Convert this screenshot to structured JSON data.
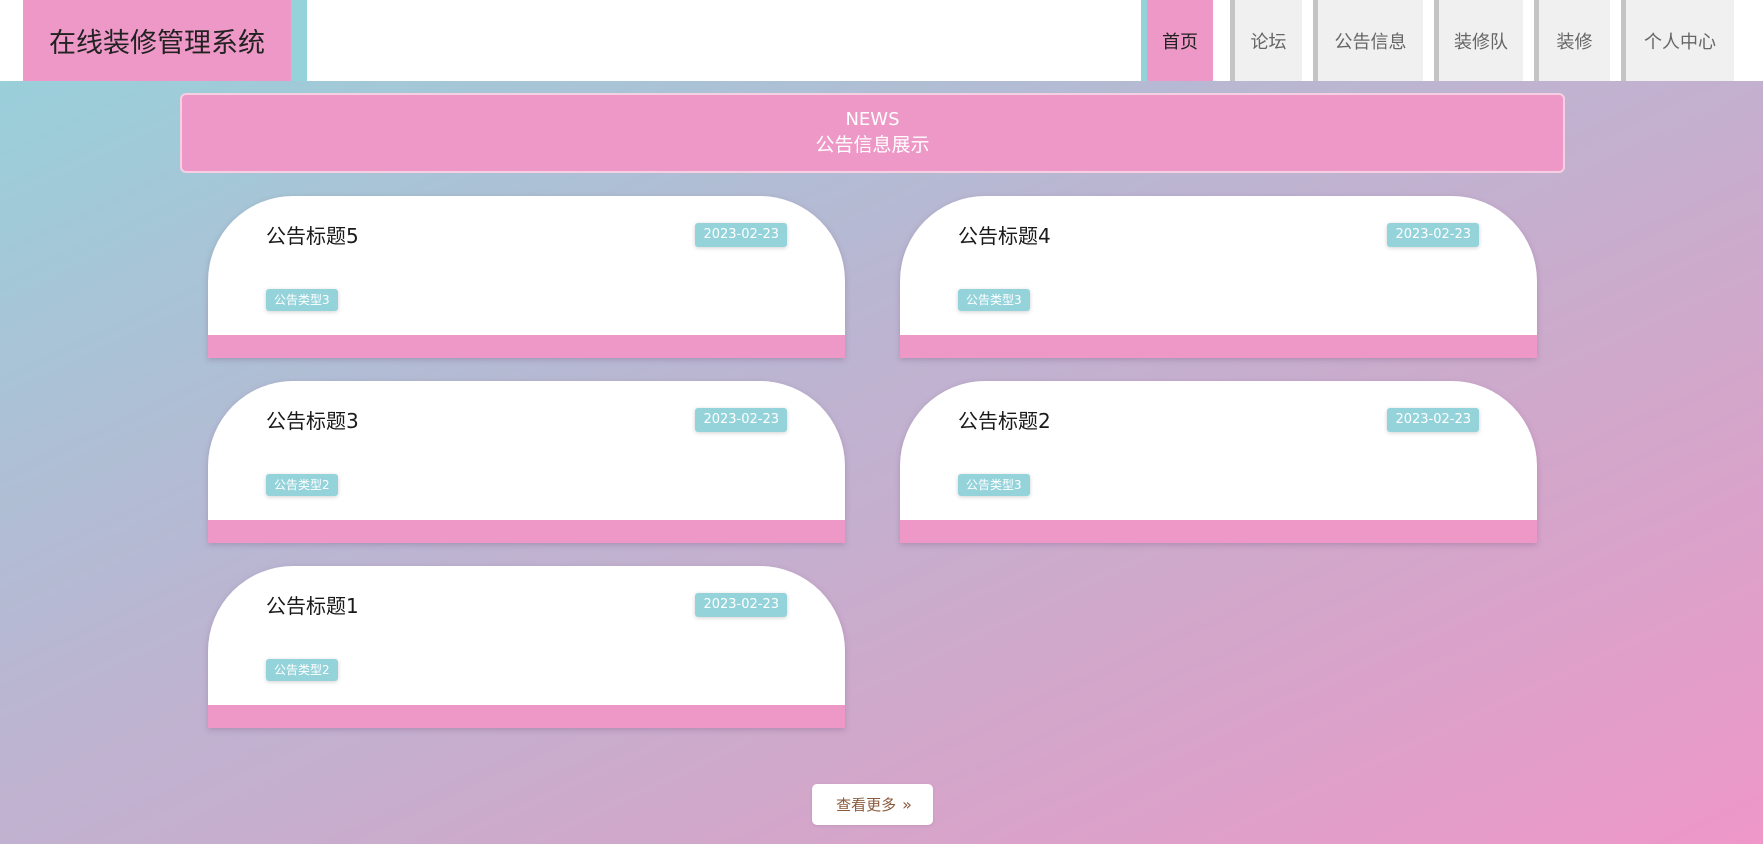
{
  "header": {
    "brand": "在线装修管理系统",
    "nav": [
      "首页",
      "论坛",
      "公告信息",
      "装修队",
      "装修",
      "个人中心"
    ],
    "active_index": 0
  },
  "banner": {
    "en": "NEWS",
    "cn": "公告信息展示"
  },
  "notices": [
    {
      "title": "公告标题5",
      "date": "2023-02-23",
      "type": "公告类型3"
    },
    {
      "title": "公告标题4",
      "date": "2023-02-23",
      "type": "公告类型3"
    },
    {
      "title": "公告标题3",
      "date": "2023-02-23",
      "type": "公告类型2"
    },
    {
      "title": "公告标题2",
      "date": "2023-02-23",
      "type": "公告类型3"
    },
    {
      "title": "公告标题1",
      "date": "2023-02-23",
      "type": "公告类型2"
    }
  ],
  "more": {
    "label": "查看更多",
    "icon": "double-chevron-right-icon"
  },
  "colors": {
    "pink": "#ee98c7",
    "teal": "#95d3db",
    "white": "#ffffff"
  }
}
